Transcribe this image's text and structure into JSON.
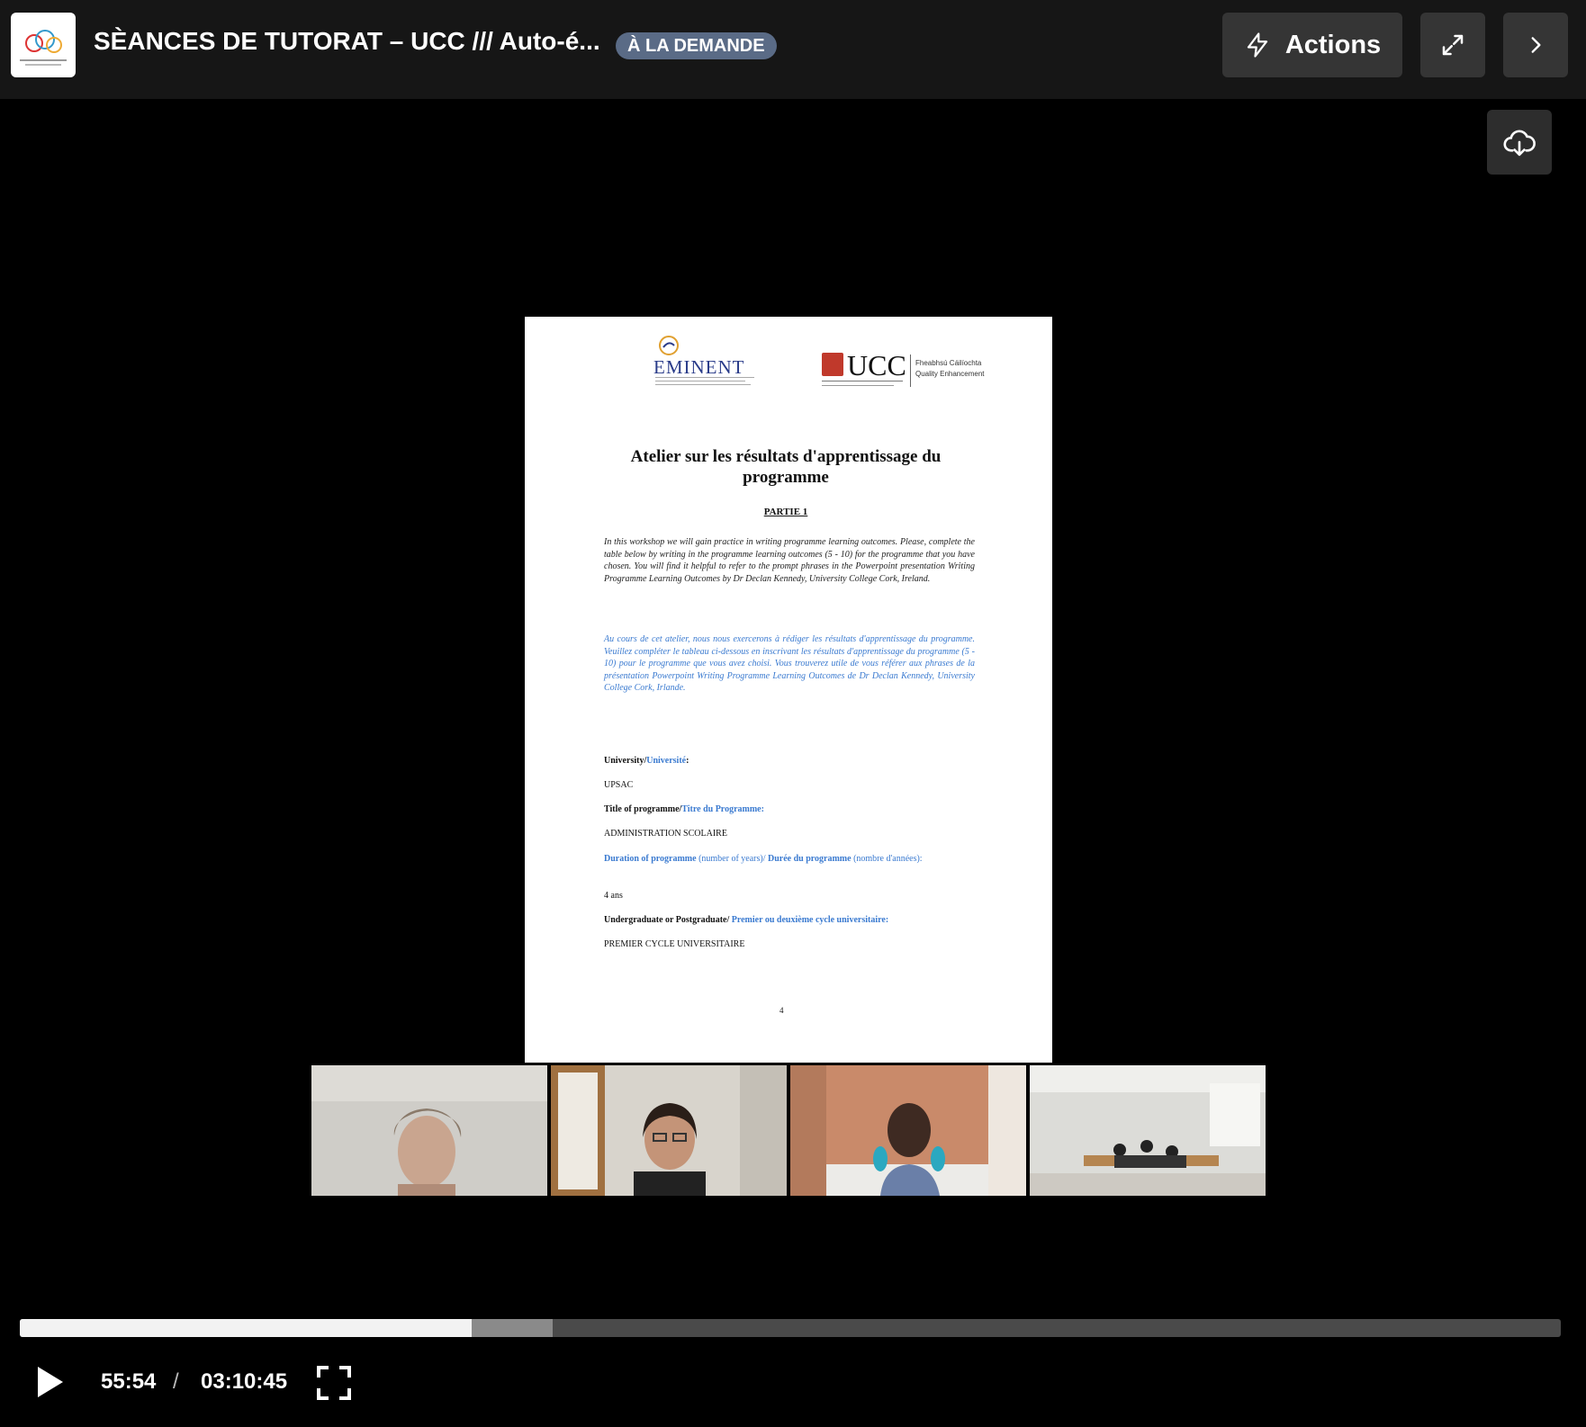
{
  "header": {
    "title": "SÈANCES DE TUTORAT – UCC /// Auto-é...",
    "badge": "À LA DEMANDE",
    "actions_label": "Actions",
    "actions_icon": "lightning-icon",
    "expand_icon": "expand-icon",
    "next_icon": "chevron-right-icon"
  },
  "player": {
    "download_icon": "cloud-download-icon",
    "current_time": "55:54",
    "separator": "/",
    "duration": "03:10:45",
    "progress_played": 0.293,
    "progress_buffered": 0.346,
    "play_icon": "play-icon",
    "fullscreen_icon": "fullscreen-icon"
  },
  "document": {
    "logo_eminent": "EMINENT",
    "logo_ucc": "UCC",
    "logo_ucc_dept": [
      "Fheabhsú Cáilíochta",
      "Quality Enhancement"
    ],
    "title": "Atelier sur les résultats d'apprentissage du programme",
    "part": "PARTIE 1",
    "intro_en": "In this workshop we will gain practice in writing programme learning outcomes. Please, complete the table below by writing in the programme learning outcomes (5 - 10) for the programme that you have chosen. You will find it helpful to refer to the prompt phrases in the Powerpoint presentation Writing Programme Learning Outcomes by Dr Declan Kennedy, University College Cork, Ireland.",
    "intro_fr": "Au cours de cet atelier, nous nous exercerons à rédiger les résultats d'apprentissage du programme. Veuillez compléter le tableau ci-dessous en inscrivant les résultats d'apprentissage du programme (5 - 10) pour le programme que vous avez choisi. Vous trouverez utile de vous référer aux phrases de la présentation Powerpoint Writing Programme Learning Outcomes de Dr Declan Kennedy, University College Cork, Irlande.",
    "university_label_en": "University/",
    "university_label_fr": "Université",
    "university_value": "UPSAC",
    "programme_label_en": "Title of programme/",
    "programme_label_fr": "Titre du Programme:",
    "programme_value": "ADMINISTRATION SCOLAIRE",
    "duration_label_en": "Duration of programme",
    "duration_hint_en": "(number of years)/",
    "duration_label_fr": "Durée du programme",
    "duration_hint_fr": "(nombre d'années):",
    "duration_value": "4 ans",
    "level_label_en": "Undergraduate or Postgraduate/",
    "level_label_fr": "Premier ou deuxième cycle universitaire:",
    "level_value": "PREMIER CYCLE UNIVERSITAIRE",
    "page_number": "4"
  },
  "colors": {
    "header_bg": "#161616",
    "button_bg": "#353535",
    "badge_bg": "#5a6b86",
    "doc_blue": "#3a7ad0",
    "progress_played": "#f2f2f2",
    "progress_buffered": "#8a8a8a",
    "progress_track": "#4a4a4a"
  }
}
